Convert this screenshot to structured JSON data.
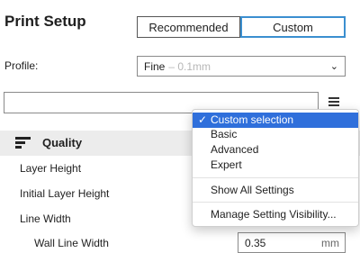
{
  "header": {
    "title": "Print Setup"
  },
  "mode": {
    "recommended_label": "Recommended",
    "custom_label": "Custom"
  },
  "profile": {
    "label": "Profile:",
    "value": "Fine",
    "hint": "– 0.1mm",
    "chevron": "⌄"
  },
  "search": {
    "placeholder": ""
  },
  "category": {
    "label": "Quality",
    "icon": "quality-icon"
  },
  "settings": [
    {
      "label": "Layer Height"
    },
    {
      "label": "Initial Layer Height"
    },
    {
      "label": "Line Width"
    },
    {
      "label": "Wall Line Width",
      "value": "0.35",
      "unit": "mm"
    }
  ],
  "visibility_menu": {
    "check_mark": "✓",
    "items": [
      {
        "label": "Custom selection",
        "selected": true
      },
      {
        "label": "Basic"
      },
      {
        "label": "Advanced"
      },
      {
        "label": "Expert"
      },
      {
        "label": "Show All Settings"
      },
      {
        "label": "Manage Setting Visibility..."
      }
    ]
  },
  "colors": {
    "accent": "#3b8fd0",
    "menu_highlight": "#2f6fdb",
    "category_bg": "#ececec"
  }
}
